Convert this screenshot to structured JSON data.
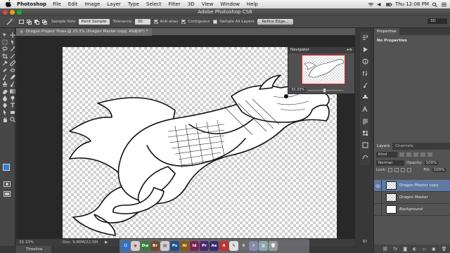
{
  "menubar": {
    "app_name": "Photoshop",
    "items": [
      "File",
      "Edit",
      "Image",
      "Layer",
      "Type",
      "Select",
      "Filter",
      "3D",
      "View",
      "Window",
      "Help"
    ],
    "clock": "Thu 12:08 PM"
  },
  "window": {
    "title": "Adobe Photoshop CS6"
  },
  "options": {
    "sample_size_label": "Sample Size:",
    "sample_size_value": "Point Sample",
    "tolerance_label": "Tolerance:",
    "tolerance_value": "30",
    "anti_alias_label": "Anti-alias",
    "anti_alias_checked": true,
    "contiguous_label": "Contiguous",
    "contiguous_checked": true,
    "sample_all_label": "Sample All Layers",
    "sample_all_checked": false,
    "refine_edge_label": "Refine Edge...",
    "workspace": "3D"
  },
  "document": {
    "tab_title": "Dragon Project Thies @ 33.3% (Dragon Master copy, RGB/8*) *",
    "zoom": "33.33%",
    "doc_size": "Doc: 9.80M/22.5M"
  },
  "navigator": {
    "title": "Navigator",
    "zoom": "33.33%"
  },
  "panels": {
    "properties_tab": "Properties",
    "properties_title": "No Properties",
    "mini_3d": "3D",
    "layers_tab": "Layers",
    "channels_tab": "Channels",
    "kind_label": "Kind",
    "blend_mode": "Normal",
    "opacity_label": "Opacity:",
    "opacity_value": "100%",
    "lock_label": "Lock:",
    "fill_label": "Fill:",
    "fill_value": "100%"
  },
  "layers": [
    {
      "name": "Dragon Master copy",
      "visible": true,
      "selected": true
    },
    {
      "name": "Dragon Master",
      "visible": false,
      "selected": false
    },
    {
      "name": "Background",
      "visible": false,
      "selected": false,
      "italic": true
    }
  ],
  "timeline": {
    "label": "Timeline"
  },
  "colors": {
    "foreground": "#2f7fd6",
    "background": "#ffffff",
    "selection": "#5d7aa3"
  },
  "dock_apps": [
    {
      "label": "Dw",
      "color": "#3b7a3b"
    },
    {
      "label": "Br",
      "color": "#6b4a2e"
    },
    {
      "label": "Ps",
      "color": "#1f4f8a"
    },
    {
      "label": "Ai",
      "color": "#8a5a10"
    },
    {
      "label": "Id",
      "color": "#7a2352"
    },
    {
      "label": "Pr",
      "color": "#4a2a6e"
    },
    {
      "label": "Ae",
      "color": "#3a2a6e"
    }
  ]
}
